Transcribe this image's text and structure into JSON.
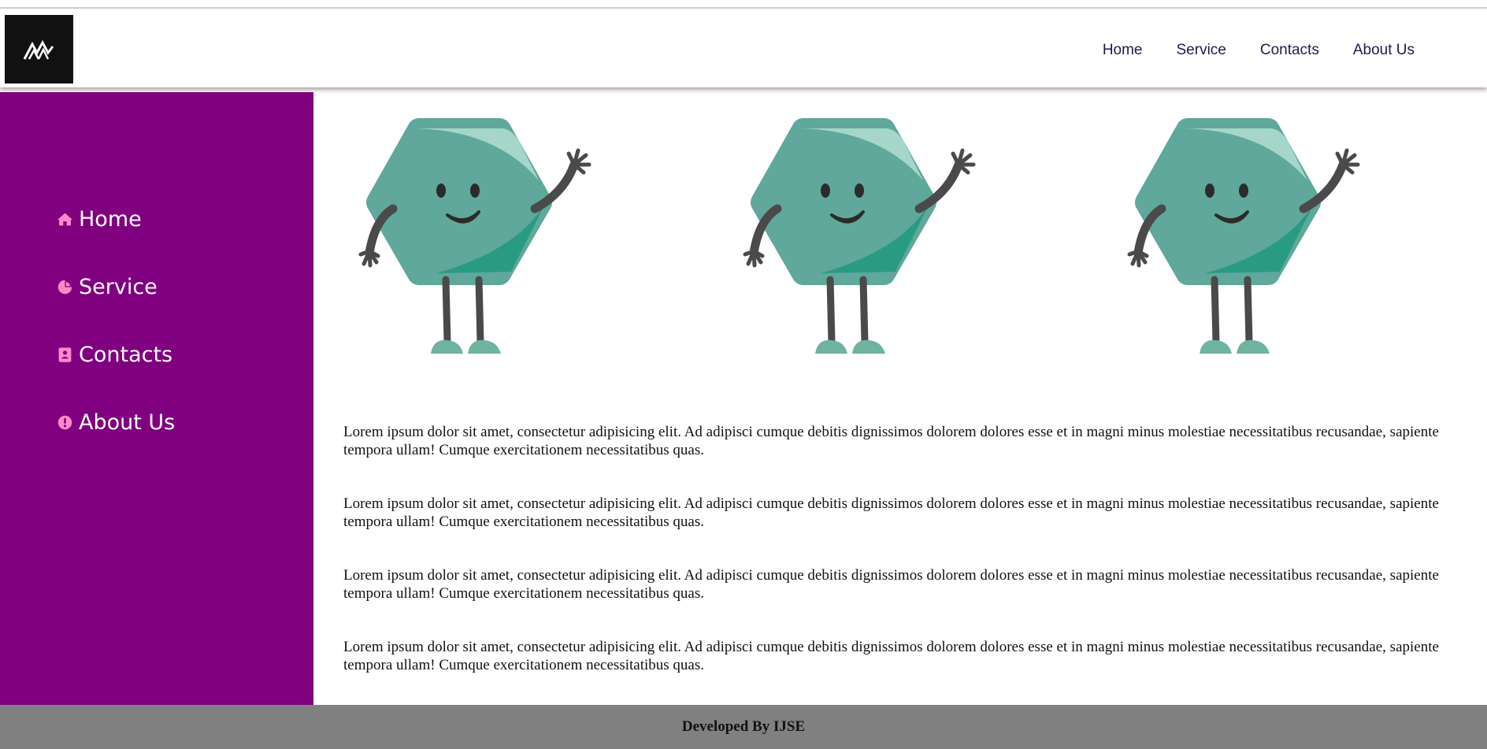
{
  "header": {
    "logo": {
      "icon": "mountain-logo-icon",
      "background": "#111111"
    },
    "nav": [
      "Home",
      "Service",
      "Contacts",
      "About Us"
    ]
  },
  "sidebar": {
    "background": "#800080",
    "icon_color": "#ff8ac8",
    "items": [
      {
        "label": "Home",
        "icon": "home-icon"
      },
      {
        "label": "Service",
        "icon": "chart-pie-icon"
      },
      {
        "label": "Contacts",
        "icon": "address-book-icon"
      },
      {
        "label": "About Us",
        "icon": "info-circle-icon"
      }
    ]
  },
  "main": {
    "illustration": {
      "name": "waving-hexagon-mascot",
      "count": 3,
      "body_color": "#5fa89b",
      "accent_color": "#2a9b83",
      "highlight_color": "#a5d6c9",
      "limb_color": "#4a4a4a",
      "shoe_color": "#6fb3a1"
    },
    "paragraphs": [
      "Lorem ipsum dolor sit amet, consectetur adipisicing elit. Ad adipisci cumque debitis dignissimos dolorem dolores esse et in magni minus molestiae necessitatibus recusandae, sapiente tempora ullam! Cumque exercitationem necessitatibus quas.",
      "Lorem ipsum dolor sit amet, consectetur adipisicing elit. Ad adipisci cumque debitis dignissimos dolorem dolores esse et in magni minus molestiae necessitatibus recusandae, sapiente tempora ullam! Cumque exercitationem necessitatibus quas.",
      "Lorem ipsum dolor sit amet, consectetur adipisicing elit. Ad adipisci cumque debitis dignissimos dolorem dolores esse et in magni minus molestiae necessitatibus recusandae, sapiente tempora ullam! Cumque exercitationem necessitatibus quas.",
      "Lorem ipsum dolor sit amet, consectetur adipisicing elit. Ad adipisci cumque debitis dignissimos dolorem dolores esse et in magni minus molestiae necessitatibus recusandae, sapiente tempora ullam! Cumque exercitationem necessitatibus quas."
    ]
  },
  "footer": {
    "text": "Developed By IJSE",
    "background": "#808080"
  }
}
